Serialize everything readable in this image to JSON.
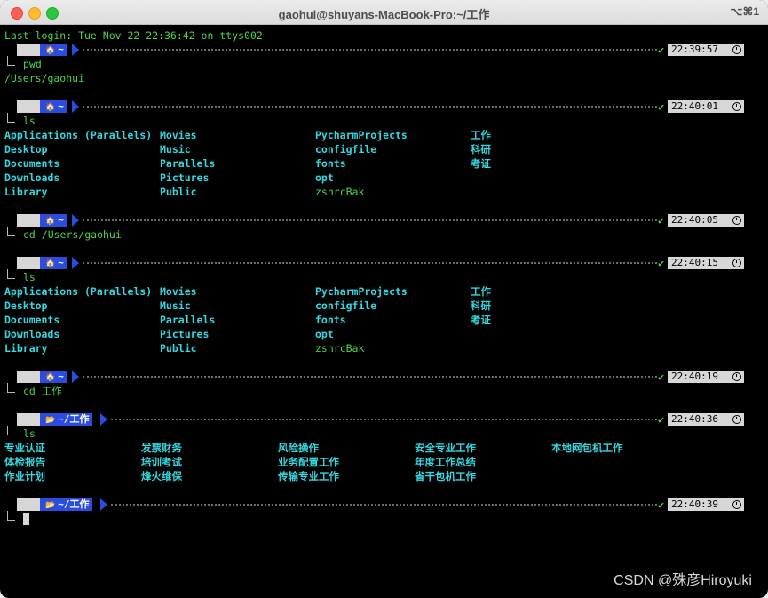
{
  "window": {
    "title": "gaohui@shuyans-MacBook-Pro:~/工作",
    "shortcut": "⌥⌘1"
  },
  "terminal": {
    "last_login": "Last login: Tue Nov 22 22:36:42 on ttys002",
    "prompts": [
      {
        "dir": "~",
        "time": "22:39:57",
        "cmd": "pwd"
      },
      {
        "dir": "~",
        "time": "22:40:01",
        "cmd": "ls"
      },
      {
        "dir": "~",
        "time": "22:40:05",
        "cmd": "cd /Users/gaohui"
      },
      {
        "dir": "~",
        "time": "22:40:15",
        "cmd": "ls"
      },
      {
        "dir": "~",
        "time": "22:40:19",
        "cmd": "cd 工作"
      },
      {
        "dir": "~/工作",
        "time": "22:40:36",
        "cmd": "ls"
      },
      {
        "dir": "~/工作",
        "time": "22:40:39",
        "cmd": ""
      }
    ],
    "pwd_output": "/Users/gaohui",
    "home_ls": [
      [
        "Applications (Parallels)",
        "Desktop",
        "Documents",
        "Downloads",
        "Library"
      ],
      [
        "Movies",
        "Music",
        "Parallels",
        "Pictures",
        "Public"
      ],
      [
        "PycharmProjects",
        "configfile",
        "fonts",
        "opt",
        "zshrcBak"
      ],
      [
        "工作",
        "科研",
        "考证"
      ]
    ],
    "work_ls": [
      [
        "专业认证",
        "体检报告",
        "作业计划"
      ],
      [
        "发票财务",
        "培训考试",
        "烽火维保"
      ],
      [
        "风险操作",
        "业务配置工作",
        "传输专业工作"
      ],
      [
        "安全专业工作",
        "年度工作总结",
        "省干包机工作"
      ],
      [
        "本地网包机工作"
      ]
    ],
    "apple_glyph": "",
    "home_glyph": "🏠",
    "folder_glyph": "📂"
  },
  "watermark": "CSDN @殊彦Hiroyuki"
}
